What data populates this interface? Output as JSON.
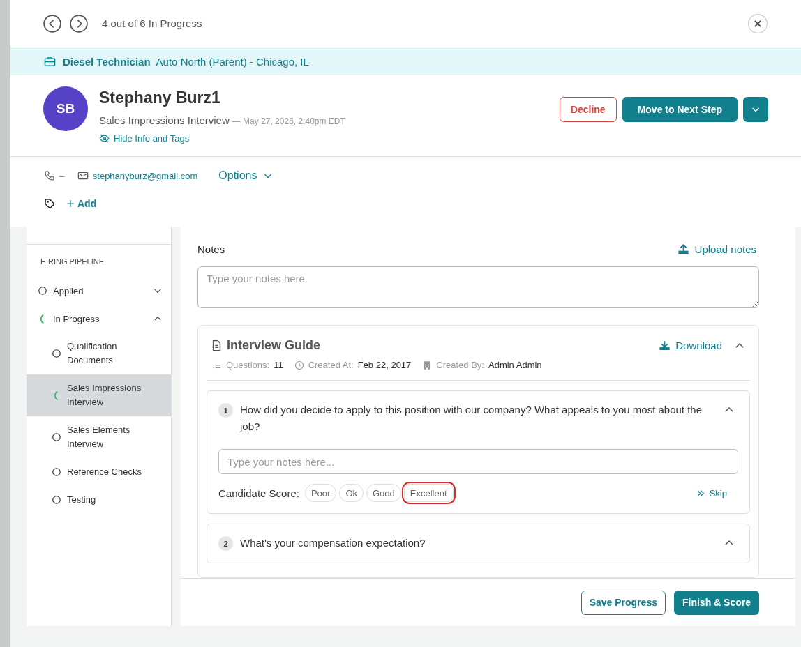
{
  "navigation": {
    "position": "4 out of 6 In Progress"
  },
  "job": {
    "title": "Diesel Technician",
    "location": "Auto North (Parent) - Chicago, IL"
  },
  "candidate": {
    "initials": "SB",
    "name": "Stephany Burz1",
    "stage": "Sales Impressions Interview",
    "date": "— May 27, 2026, 2:40pm EDT",
    "toggle": "Hide Info and Tags"
  },
  "actions": [
    {
      "kind": "outline",
      "label": "Decline"
    },
    {
      "kind": "primary",
      "label": "Move to Next Step"
    },
    {
      "kind": "menu"
    }
  ],
  "contact": {
    "phone": "–",
    "email": "stephanyburz@gmail.com",
    "options": "Options",
    "add_tag": "Add"
  },
  "sidebar": {
    "section": "HIRING PIPELINE",
    "items": [
      {
        "label": "Applied",
        "kind": "pending",
        "expanded": false,
        "selected": false
      },
      {
        "label": "In Progress",
        "kind": "in_progress",
        "expanded": true,
        "selected": false,
        "children": [
          {
            "label": "Qualification Documents",
            "kind": "pending",
            "selected": false
          },
          {
            "label": "Sales Impressions Interview",
            "kind": "in_progress",
            "selected": true
          },
          {
            "label": "Sales Elements Interview",
            "kind": "pending",
            "selected": false
          },
          {
            "label": "Reference Checks",
            "kind": "pending",
            "selected": false
          },
          {
            "label": "Testing",
            "kind": "pending",
            "selected": false
          }
        ]
      }
    ]
  },
  "notes": {
    "title": "Notes",
    "upload": "Upload notes",
    "placeholder": "Type your notes here"
  },
  "guide": {
    "title": "Interview Guide",
    "download": "Download",
    "expanded": true,
    "meta": [
      {
        "kind": "questions",
        "label": "Questions:",
        "value": "11"
      },
      {
        "kind": "created_at",
        "label": "Created At:",
        "value": "Feb 22, 2017"
      },
      {
        "kind": "created_by",
        "label": "Created By:",
        "value": "Admin Admin"
      }
    ],
    "questions": [
      {
        "number": "1",
        "text": "How did you decide to apply to this position with our company? What appeals to you most about the job?",
        "expanded": true,
        "placeholder": "Type your notes here...",
        "score_label": "Candidate Score:",
        "scores": [
          {
            "label": "Poor",
            "selected": false
          },
          {
            "label": "Ok",
            "selected": false
          },
          {
            "label": "Good",
            "selected": false
          },
          {
            "label": "Excellent",
            "selected": true
          }
        ],
        "skip": "Skip"
      },
      {
        "number": "2",
        "text": "What's your compensation expectation?",
        "expanded": true
      }
    ]
  },
  "footer": {
    "buttons": [
      {
        "kind": "outline",
        "label": "Save Progress"
      },
      {
        "kind": "primary",
        "label": "Finish & Score"
      }
    ]
  }
}
